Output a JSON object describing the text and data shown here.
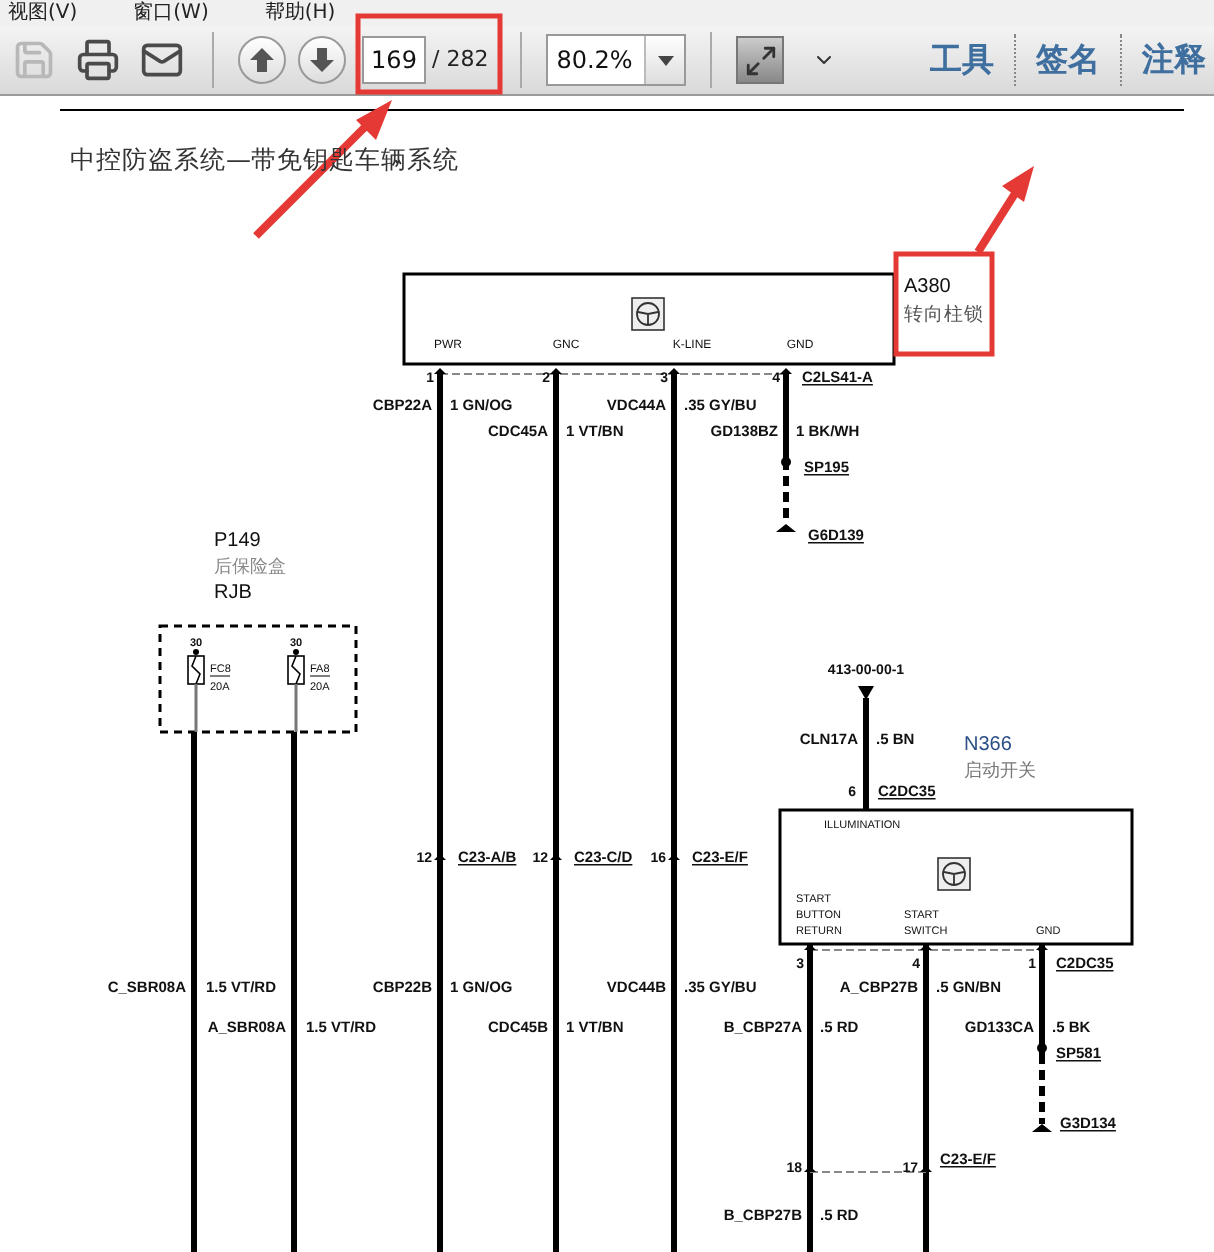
{
  "menu": [
    "视图(V)",
    "窗口(W)",
    "帮助(H)"
  ],
  "toolbar": {
    "icon_buttons": [
      {
        "kind": "save",
        "disabled": true
      },
      {
        "kind": "print",
        "disabled": false
      },
      {
        "kind": "mail",
        "disabled": false
      },
      {
        "kind": "prev",
        "disabled": false
      },
      {
        "kind": "next",
        "disabled": false
      }
    ],
    "page_field": {
      "value": "169"
    },
    "page_total": "/ 282",
    "zoom_field": {
      "value": "80.2%"
    },
    "panels": [
      "工具",
      "签名",
      "注释"
    ]
  },
  "diagram": {
    "title": "中控防盗系统—带免钥匙车辆系统",
    "a380": {
      "id": "A380",
      "name": "转向柱锁",
      "connector": "C2LS41-A",
      "pins": [
        {
          "label": "PWR",
          "number": "1",
          "circuit": "CBP22A",
          "spec": "1 GN/OG"
        },
        {
          "label": "GNC",
          "number": "2",
          "circuit": "CDC45A",
          "spec": "1 VT/BN"
        },
        {
          "label": "K-LINE",
          "number": "3",
          "circuit": "VDC44A",
          "spec": ".35 GY/BU"
        },
        {
          "label": "GND",
          "number": "4",
          "circuit": "GD138BZ",
          "spec": "1 BK/WH"
        }
      ],
      "splice": "SP195",
      "ground": "G6D139"
    },
    "inline_connectors": [
      {
        "number": "12",
        "name": "C23-A/B"
      },
      {
        "number": "12",
        "name": "C23-C/D"
      },
      {
        "number": "16",
        "name": "C23-E/F"
      }
    ],
    "lower_wires": [
      {
        "circuit": "CBP22B",
        "spec": "1 GN/OG"
      },
      {
        "circuit": "CDC45B",
        "spec": "1 VT/BN"
      },
      {
        "circuit": "VDC44B",
        "spec": ".35 GY/BU"
      }
    ],
    "rjb": {
      "id": "P149",
      "name": "后保险盒",
      "code": "RJB",
      "fuses": [
        {
          "terminal": "30",
          "name": "FC8",
          "rating": "20A",
          "circuit": "C_SBR08A",
          "spec": "1.5 VT/RD"
        },
        {
          "terminal": "30",
          "name": "FA8",
          "rating": "20A",
          "circuit": "A_SBR08A",
          "spec": "1.5 VT/RD"
        }
      ]
    },
    "n366": {
      "id": "N366",
      "name": "启动开关",
      "top_label": "ILLUMINATION",
      "feed": {
        "reference": "413-00-00-1",
        "circuit": "CLN17A",
        "spec": ".5 BN",
        "number": "6",
        "connector": "C2DC35"
      },
      "connector": "C2DC35",
      "pins": [
        {
          "label_lines": [
            "START",
            "BUTTON",
            "RETURN"
          ],
          "number": "3",
          "circuit": "B_CBP27A",
          "spec": ".5 RD"
        },
        {
          "label_lines": [
            "START",
            "SWITCH"
          ],
          "number": "4",
          "circuit": "A_CBP27B",
          "spec": ".5 GN/BN"
        },
        {
          "label_lines": [
            "GND"
          ],
          "number": "1",
          "circuit": "GD133CA",
          "spec": ".5 BK"
        }
      ],
      "splice": "SP581",
      "ground": "G3D134"
    },
    "lower_connector": {
      "numbers": [
        "18",
        "17"
      ],
      "name": "C23-E/F",
      "circuit": "B_CBP27B",
      "spec": ".5 RD"
    }
  }
}
